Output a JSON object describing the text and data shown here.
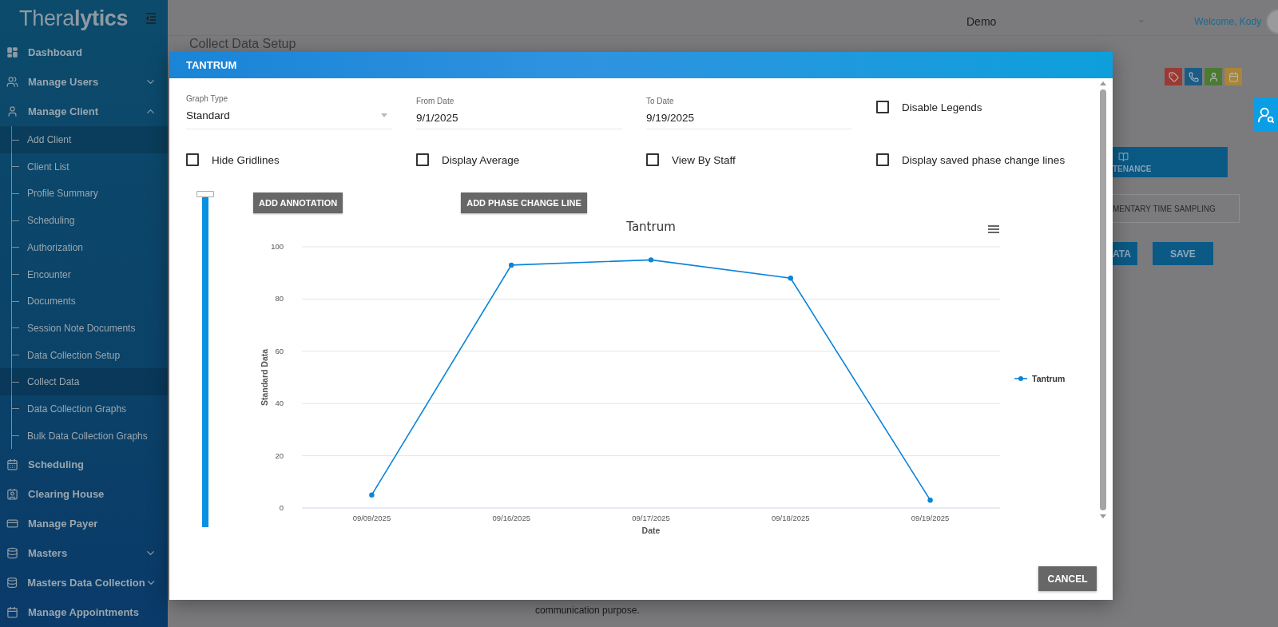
{
  "sidebar": {
    "logo": "Thera**lytics**",
    "items": [
      {
        "label": "Dashboard"
      },
      {
        "label": "Manage Users",
        "expanded": false
      },
      {
        "label": "Manage Client",
        "expanded": true,
        "children": [
          {
            "label": "Add Client",
            "selected": true
          },
          {
            "label": "Client List",
            "selected": false
          },
          {
            "label": "Profile Summary",
            "selected": false
          },
          {
            "label": "Scheduling",
            "selected": false
          },
          {
            "label": "Authorization",
            "selected": false
          },
          {
            "label": "Encounter",
            "selected": false
          },
          {
            "label": "Documents",
            "selected": false
          },
          {
            "label": "Session Note Documents",
            "selected": false
          },
          {
            "label": "Data Collection Setup",
            "selected": false
          },
          {
            "label": "Collect Data",
            "selected": true
          },
          {
            "label": "Data Collection Graphs",
            "selected": false
          },
          {
            "label": "Bulk Data Collection Graphs",
            "selected": false
          }
        ]
      },
      {
        "label": "Scheduling"
      },
      {
        "label": "Clearing House"
      },
      {
        "label": "Manage Payer"
      },
      {
        "label": "Masters",
        "expanded": false
      },
      {
        "label": "Masters Data Collection",
        "expanded": false
      },
      {
        "label": "Manage Appointments"
      }
    ]
  },
  "header": {
    "location": "Demo",
    "welcome": "Welcome, Kody"
  },
  "page": {
    "title": "Collect Data Setup",
    "tab": "TENANCE",
    "method": "MENTARY TIME SAMPLING",
    "buttons": [
      "ATA",
      "SAVE"
    ],
    "footnote": "communication purpose."
  },
  "dialog": {
    "title": "TANTRUM",
    "fields": [
      {
        "label": "Graph Type",
        "value": "Standard",
        "kind": "select"
      },
      {
        "label": "From Date",
        "value": "9/1/2025",
        "kind": "text"
      },
      {
        "label": "To Date",
        "value": "9/19/2025",
        "kind": "text"
      }
    ],
    "options": [
      {
        "label": "Disable Legends",
        "checked": false
      },
      {
        "label": "Hide Gridlines",
        "checked": false
      },
      {
        "label": "Display Average",
        "checked": false
      },
      {
        "label": "View By Staff",
        "checked": false
      },
      {
        "label": "Display saved phase change lines",
        "checked": false
      }
    ],
    "zoom": {
      "level": 1
    },
    "actions": [
      "ADD ANNOTATION",
      "ADD PHASE CHANGE LINE"
    ],
    "chart_data": {
      "type": "line",
      "title": "Tantrum",
      "xlabel": "Date",
      "ylabel": "Standard Data",
      "categories": [
        "09/09/2025",
        "09/16/2025",
        "09/17/2025",
        "09/18/2025",
        "09/19/2025"
      ],
      "series": [
        {
          "name": "Tantrum",
          "color": "#0a84d8",
          "values": [
            5,
            93,
            95,
            88,
            3
          ]
        }
      ],
      "grid": true,
      "marker": true,
      "ylim": [
        0,
        100
      ],
      "yticks": [
        0,
        20,
        40,
        60,
        80,
        100
      ]
    },
    "cancel": "CANCEL"
  }
}
